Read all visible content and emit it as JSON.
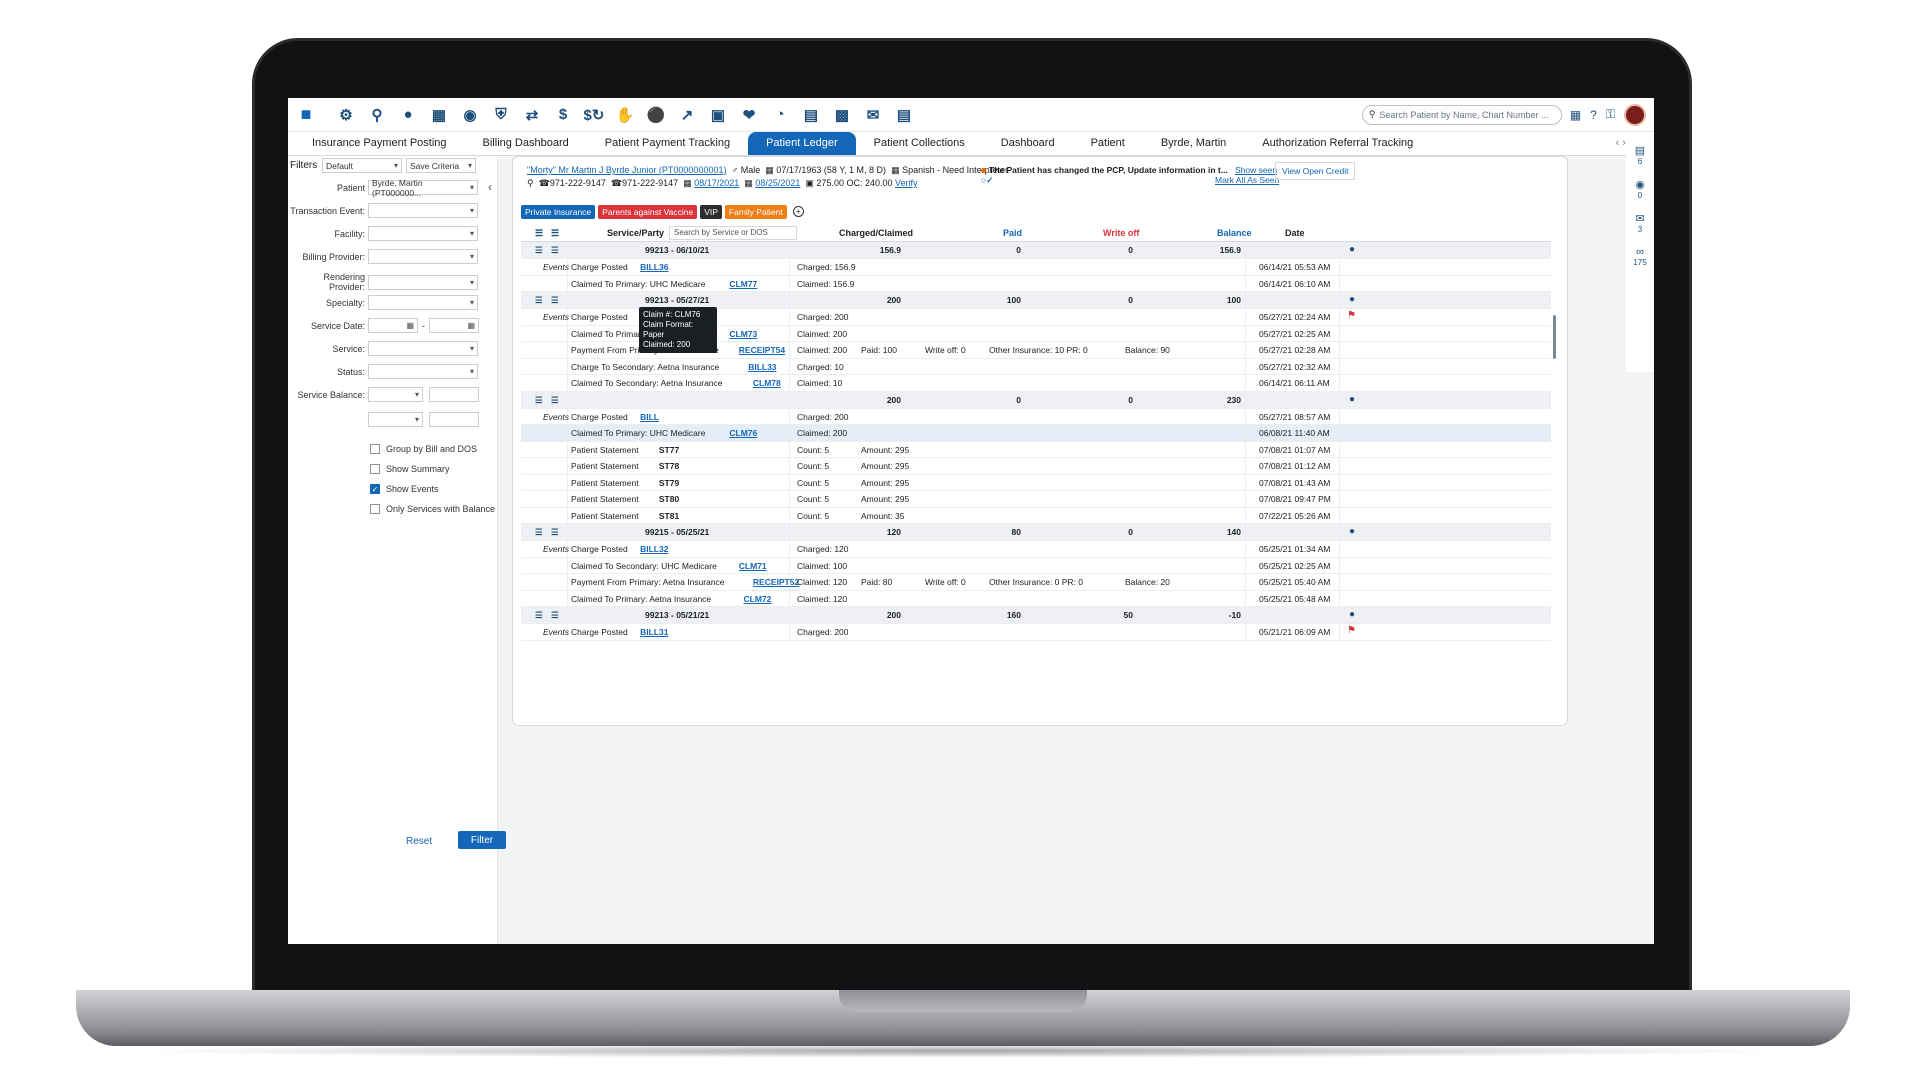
{
  "toolbar": {
    "icons": [
      "messages-icon",
      "gear-icon",
      "search-icon",
      "user-icon",
      "calendar-icon",
      "user-group-icon",
      "shield-icon",
      "transfer-icon",
      "dollar-icon",
      "dollar-refresh-icon",
      "hand-money-icon",
      "money-bag-icon",
      "chart-hand-icon",
      "safe-icon",
      "donation-icon",
      "pie-chart-icon",
      "document-icon",
      "book-icon",
      "inbox-icon",
      "analytics-icon"
    ],
    "search_placeholder": "Search Patient by Name, Chart Number ..."
  },
  "tabs": [
    {
      "label": "Insurance Payment Posting",
      "active": false
    },
    {
      "label": "Billing Dashboard",
      "active": false
    },
    {
      "label": "Patient Payment Tracking",
      "active": false
    },
    {
      "label": "Patient Ledger",
      "active": true
    },
    {
      "label": "Patient Collections",
      "active": false
    },
    {
      "label": "Dashboard",
      "active": false
    },
    {
      "label": "Patient",
      "active": false
    },
    {
      "label": "Byrde, Martin",
      "active": false
    },
    {
      "label": "Authorization Referral Tracking",
      "active": false
    }
  ],
  "filters": {
    "title": "Filters",
    "preset": "Default",
    "save_criteria": "Save Criteria",
    "patient_label": "Patient",
    "patient_value": "Byrde, Martin (PT000000...",
    "transaction_event_label": "Transaction Event:",
    "facility_label": "Facility:",
    "billing_provider_label": "Billing Provider:",
    "rendering_provider_label": "Rendering Provider:",
    "specialty_label": "Specialty:",
    "service_date_label": "Service Date:",
    "service_label": "Service:",
    "status_label": "Status:",
    "service_balance_label": "Service Balance:",
    "group_by_bill": "Group by Bill and DOS",
    "show_summary": "Show Summary",
    "show_events": "Show Events",
    "only_services_balance": "Only Services with Balance",
    "reset": "Reset",
    "filter": "Filter"
  },
  "patient": {
    "name_line": "\"Morty\" Mr Martin J Byrde Junior (PT0000000001)",
    "gender": "Male",
    "dob": "07/17/1963 (58 Y, 1 M, 8 D)",
    "language": "Spanish - Need Interpreter",
    "phone1": "971-222-9147",
    "phone2": "971-222-9147",
    "date1": "08/17/2021",
    "date2": "08/25/2021",
    "balance": "275.00 OC: 240.00",
    "verify": "Verify",
    "alert": "The Patient has changed the PCP, Update information in t...",
    "show_seen": "Show seen",
    "mark_all_seen": "Mark All As Seen",
    "view_open_credit": "View Open Credit"
  },
  "tags": [
    {
      "label": "Private Insurance",
      "color": "#1466b8"
    },
    {
      "label": "Parents against Vaccine",
      "color": "#d9343a"
    },
    {
      "label": "VIP",
      "color": "#2d2d2d"
    },
    {
      "label": "Family Patient",
      "color": "#ef7d16"
    }
  ],
  "grid": {
    "headers": {
      "service_party": "Service/Party",
      "search_placeholder": "Search by Service or DOS",
      "charged": "Charged/Claimed",
      "paid": "Paid",
      "write_off": "Write off",
      "balance": "Balance",
      "date": "Date"
    },
    "rows": [
      {
        "type": "svc",
        "service": "99213 - 06/10/21",
        "charged": "156.9",
        "paid": "0",
        "writeoff": "0",
        "balance": "156.9"
      },
      {
        "type": "ev",
        "events": "Events",
        "text": "Charge Posted",
        "link": "BILL36",
        "amount": "Charged: 156.9",
        "date": "06/14/21 05:53 AM"
      },
      {
        "type": "ev",
        "text": "Claimed To Primary: UHC Medicare",
        "link": "CLM77",
        "amount": "Claimed: 156.9",
        "date": "06/14/21 06:10 AM"
      },
      {
        "type": "svc",
        "service": "99213 - 05/27/21",
        "charged": "200",
        "paid": "100",
        "writeoff": "0",
        "balance": "100"
      },
      {
        "type": "ev",
        "events": "Events",
        "text": "Charge Posted",
        "link": "BILL33",
        "amount": "Charged: 200",
        "date": "05/27/21 02:24 AM",
        "flag": true
      },
      {
        "type": "ev",
        "text": "Claimed To Primary: UHC Medicare",
        "link": "CLM73",
        "amount": "Claimed: 200",
        "date": "05/27/21 02:25 AM"
      },
      {
        "type": "ev",
        "text": "Payment From Primary: UHC Medicare",
        "link": "RECEIPT54",
        "amount": "Claimed: 200",
        "paid": "Paid: 100",
        "wo": "Write off: 0",
        "other": "Other Insurance: 10   PR: 0",
        "bal": "Balance: 90",
        "date": "05/27/21 02:28 AM"
      },
      {
        "type": "ev",
        "text": "Charge To Secondary: Aetna Insurance",
        "link": "BILL33",
        "amount": "Charged: 10",
        "date": "05/27/21 02:32 AM"
      },
      {
        "type": "ev",
        "text": "Claimed To Secondary: Aetna Insurance",
        "link": "CLM78",
        "amount": "Claimed: 10",
        "date": "06/14/21 06:11 AM"
      },
      {
        "type": "svc",
        "service": "",
        "charged": "200",
        "paid": "0",
        "writeoff": "0",
        "balance": "230"
      },
      {
        "type": "ev",
        "events": "Events",
        "text": "Charge Posted",
        "link": "BILL",
        "amount": "Charged: 200",
        "date": "05/27/21 08:57 AM"
      },
      {
        "type": "ev",
        "hl": true,
        "text": "Claimed To Primary: UHC Medicare",
        "link": "CLM76",
        "amount": "Claimed: 200",
        "date": "06/08/21 11:40 AM"
      },
      {
        "type": "ev",
        "text": "Patient Statement",
        "bold": "ST77",
        "amount": "Count: 5",
        "paid": "Amount: 295",
        "date": "07/08/21 01:07 AM"
      },
      {
        "type": "ev",
        "text": "Patient Statement",
        "bold": "ST78",
        "amount": "Count: 5",
        "paid": "Amount: 295",
        "date": "07/08/21 01:12 AM"
      },
      {
        "type": "ev",
        "text": "Patient Statement",
        "bold": "ST79",
        "amount": "Count: 5",
        "paid": "Amount: 295",
        "date": "07/08/21 01:43 AM"
      },
      {
        "type": "ev",
        "text": "Patient Statement",
        "bold": "ST80",
        "amount": "Count: 5",
        "paid": "Amount: 295",
        "date": "07/08/21 09:47 PM"
      },
      {
        "type": "ev",
        "text": "Patient Statement",
        "bold": "ST81",
        "amount": "Count: 5",
        "paid": "Amount: 35",
        "date": "07/22/21 05:26 AM"
      },
      {
        "type": "svc",
        "service": "99215 - 05/25/21",
        "charged": "120",
        "paid": "80",
        "writeoff": "0",
        "balance": "140"
      },
      {
        "type": "ev",
        "events": "Events",
        "text": "Charge Posted",
        "link": "BILL32",
        "amount": "Charged: 120",
        "date": "05/25/21 01:34 AM"
      },
      {
        "type": "ev",
        "text": "Claimed To Secondary: UHC Medicare",
        "link": "CLM71",
        "amount": "Claimed: 100",
        "date": "05/25/21 02:25 AM"
      },
      {
        "type": "ev",
        "text": "Payment From Primary: Aetna Insurance",
        "link": "RECEIPT52",
        "amount": "Claimed: 120",
        "paid": "Paid: 80",
        "wo": "Write off: 0",
        "other": "Other Insurance: 0   PR: 0",
        "bal": "Balance: 20",
        "date": "05/25/21 05:40 AM"
      },
      {
        "type": "ev",
        "text": "Claimed To Primary: Aetna Insurance",
        "link": "CLM72",
        "amount": "Claimed: 120",
        "date": "05/25/21 05:48 AM"
      },
      {
        "type": "svc",
        "service": "99213 - 05/21/21",
        "charged": "200",
        "paid": "160",
        "writeoff": "50",
        "balance": "-10"
      },
      {
        "type": "ev",
        "events": "Events",
        "text": "Charge Posted",
        "link": "BILL31",
        "amount": "Charged: 200",
        "date": "05/21/21 06:09 AM",
        "flag": true
      }
    ]
  },
  "tooltip": {
    "line1": "Claim #: CLM76",
    "line2": "Claim Format: Paper",
    "line3": "Claimed: 200"
  },
  "rightbar": [
    {
      "icon": "clipboard-icon",
      "count": "6"
    },
    {
      "icon": "chat-icon",
      "count": "0"
    },
    {
      "icon": "mail-icon",
      "count": "3"
    },
    {
      "icon": "voicemail-icon",
      "count": "175"
    }
  ]
}
